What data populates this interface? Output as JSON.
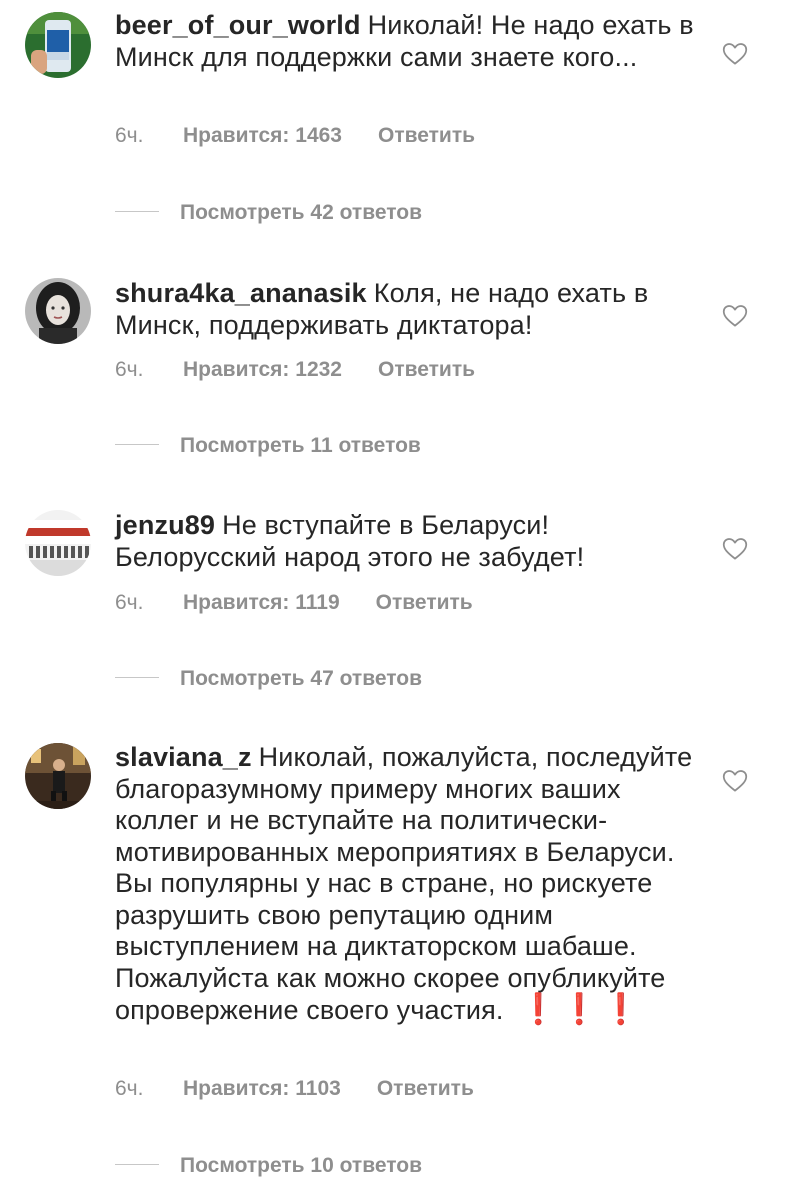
{
  "comments": [
    {
      "username": "beer_of_our_world",
      "text": "Николай! Не надо ехать в Минск для поддержки сами знаете кого...",
      "time": "6ч.",
      "likes": "Нравится: 1463",
      "reply": "Ответить",
      "view_replies": "Посмотреть 42 ответов",
      "like_icon": "heart-outline-icon"
    },
    {
      "username": "shura4ka_ananasik",
      "text": "Коля, не надо ехать в Минск, поддерживать диктатора!",
      "time": "6ч.",
      "likes": "Нравится: 1232",
      "reply": "Ответить",
      "view_replies": "Посмотреть 11 ответов",
      "like_icon": "heart-outline-icon"
    },
    {
      "username": "jenzu89",
      "text": "Не вступайте в Беларуси! Белорусский народ этого не забудет!",
      "time": "6ч.",
      "likes": "Нравится: 1119",
      "reply": "Ответить",
      "view_replies": "Посмотреть 47 ответов",
      "like_icon": "heart-outline-icon"
    },
    {
      "username": "slaviana_z",
      "text": "Николай, пожалуйста, последуйте благоразумному примеру многих ваших коллег и не вступайте на политически-мотивированных мероприятиях в Беларуси. Вы популярны у нас в стране, но рискуете разрушить свою репутацию одним выступлением на диктаторском шабаше. Пожалуйста как можно скорее опубликуйте опровержение своего участия.",
      "emoji": "❗❗❗",
      "time": "6ч.",
      "likes": "Нравится: 1103",
      "reply": "Ответить",
      "view_replies": "Посмотреть 10 ответов",
      "like_icon": "heart-outline-icon"
    }
  ],
  "colors": {
    "text": "#262626",
    "secondary": "#8e8e8e",
    "emoji_red": "#d31616"
  }
}
